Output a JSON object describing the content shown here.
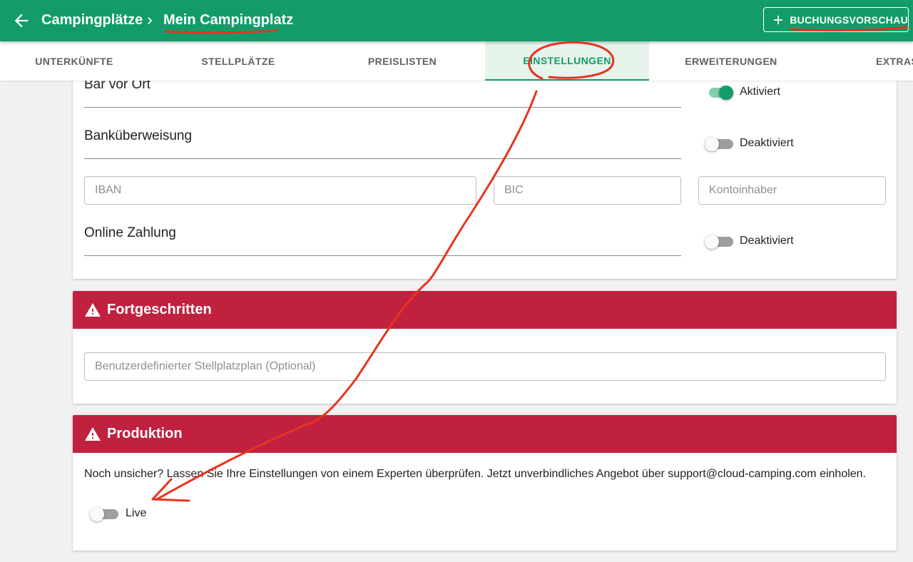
{
  "header": {
    "breadcrumb_parent": "Campingplätze",
    "breadcrumb_current": "Mein Campingplatz",
    "preview_button": "BUCHUNGSVORSCHAU"
  },
  "tabs": [
    {
      "label": "UNTERKÜNFTE",
      "active": false
    },
    {
      "label": "STELLPLÄTZE",
      "active": false
    },
    {
      "label": "PREISLISTEN",
      "active": false
    },
    {
      "label": "EINSTELLUNGEN",
      "active": true
    },
    {
      "label": "ERWEITERUNGEN",
      "active": false
    },
    {
      "label": "EXTRAS",
      "active": false
    }
  ],
  "payments": {
    "cash": {
      "label": "Bar vor Ort",
      "state": "Aktiviert",
      "on": true
    },
    "bank": {
      "label": "Banküberweisung",
      "state": "Deaktiviert",
      "on": false
    },
    "bank_fields": {
      "iban": "IBAN",
      "bic": "BIC",
      "holder": "Kontoinhaber"
    },
    "online": {
      "label": "Online Zahlung",
      "state": "Deaktiviert",
      "on": false
    }
  },
  "advanced": {
    "title": "Fortgeschritten",
    "custom_plan_placeholder": "Benutzerdefinierter Stellplatzplan (Optional)"
  },
  "production": {
    "title": "Produktion",
    "note": "Noch unsicher? Lassen Sie Ihre Einstellungen von einem Experten überprüfen. Jetzt unverbindliches Angebot über support@cloud-camping.com einholen.",
    "live_label": "Live",
    "live_on": false
  },
  "colors": {
    "primary": "#139c69",
    "danger": "#c0213f",
    "annotation": "#e8331f"
  }
}
